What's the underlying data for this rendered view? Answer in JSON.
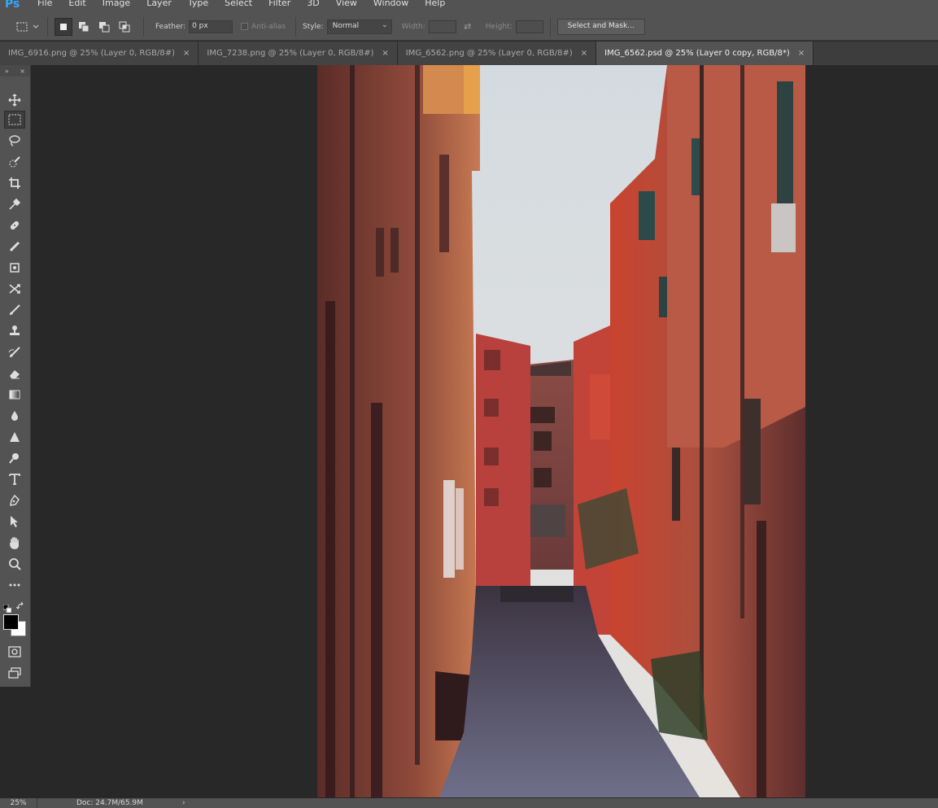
{
  "app": {
    "logo": "Ps"
  },
  "menu": {
    "items": [
      "File",
      "Edit",
      "Image",
      "Layer",
      "Type",
      "Select",
      "Filter",
      "3D",
      "View",
      "Window",
      "Help"
    ]
  },
  "options": {
    "feather_label": "Feather:",
    "feather_value": "0 px",
    "antialias_label": "Anti-alias",
    "style_label": "Style:",
    "style_value": "Normal",
    "width_label": "Width:",
    "height_label": "Height:",
    "select_mask_label": "Select and Mask..."
  },
  "tabs": [
    {
      "label": "IMG_6916.png @ 25% (Layer 0, RGB/8#)",
      "active": false
    },
    {
      "label": "IMG_7238.png @ 25% (Layer 0, RGB/8#)",
      "active": false
    },
    {
      "label": "IMG_6562.png @ 25% (Layer 0, RGB/8#)",
      "active": false
    },
    {
      "label": "IMG_6562.psd @ 25% (Layer 0 copy, RGB/8*)",
      "active": true
    }
  ],
  "status": {
    "zoom": "25%",
    "doc": "Doc: 24.7M/65.9M",
    "arrow": "›"
  },
  "icons": {
    "close": "×",
    "close_panel": "×",
    "collapse": "»",
    "swap": "⇄",
    "chevron": "⌄"
  },
  "colors": {
    "accent": "#31a8ff",
    "foreground_swatch": "#000000",
    "background_swatch": "#ffffff"
  }
}
